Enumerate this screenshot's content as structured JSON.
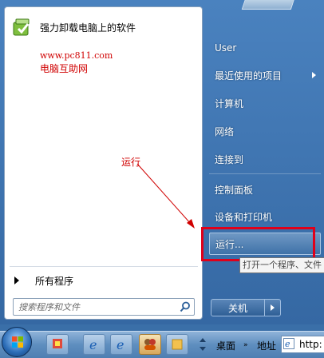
{
  "start_menu": {
    "pinned_programs": [
      {
        "label": "强力卸载电脑上的软件",
        "icon": "uninstall-app-icon"
      }
    ],
    "watermark": {
      "url": "www.pc811.com",
      "name": "电脑互助网"
    },
    "all_programs_label": "所有程序",
    "search": {
      "placeholder": "搜索程序和文件"
    },
    "right_items": [
      {
        "label": "User"
      },
      {
        "label": "最近使用的项目",
        "has_submenu": true
      },
      {
        "label": "计算机"
      },
      {
        "label": "网络"
      },
      {
        "label": "连接到"
      },
      {
        "label": "控制面板"
      },
      {
        "label": "设备和打印机"
      },
      {
        "label": "运行..."
      }
    ],
    "tooltip": "打开一个程序、文件",
    "shutdown_label": "关机"
  },
  "annotation": {
    "label": "运行"
  },
  "taskbar": {
    "desktop_label": "桌面",
    "address_label": "地址",
    "address_value": "http:"
  },
  "colors": {
    "annotation_red": "#d00000",
    "highlight_red": "#e0001a",
    "menu_blue": "#3568a3"
  }
}
